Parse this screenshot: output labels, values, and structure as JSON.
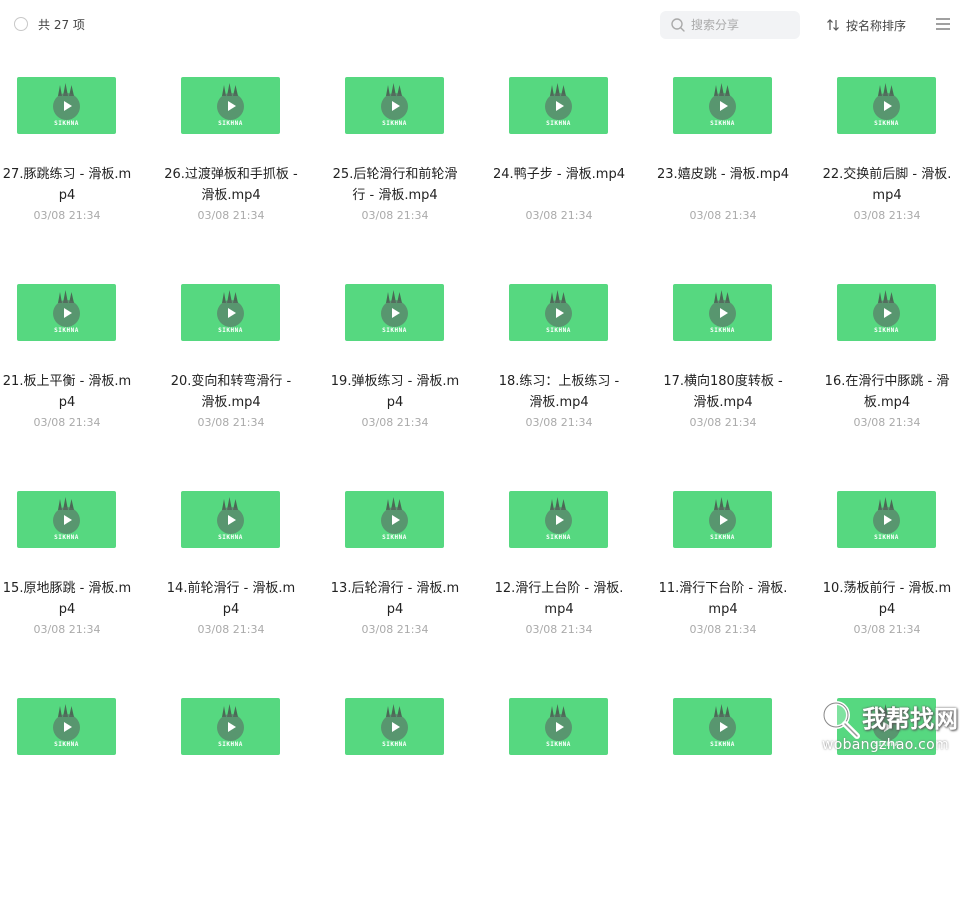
{
  "header": {
    "count_label": "共 27 项",
    "search_placeholder": "搜索分享",
    "sort_label": "按名称排序",
    "search_icon": "search-icon",
    "sort_icon": "sort-arrows-icon",
    "menu_icon": "list-menu-icon"
  },
  "thumbnail": {
    "brand": "SIKHNA",
    "color": "#56d880"
  },
  "files": [
    {
      "name": "27.豚跳练习 - 滑板.mp4",
      "time": "03/08 21:34"
    },
    {
      "name": "26.过渡弹板和手抓板 - 滑板.mp4",
      "time": "03/08 21:34"
    },
    {
      "name": "25.后轮滑行和前轮滑行 - 滑板.mp4",
      "time": "03/08 21:34"
    },
    {
      "name": "24.鸭子步 - 滑板.mp4",
      "time": "03/08 21:34"
    },
    {
      "name": "23.嬉皮跳 - 滑板.mp4",
      "time": "03/08 21:34"
    },
    {
      "name": "22.交换前后脚 - 滑板.mp4",
      "time": "03/08 21:34"
    },
    {
      "name": "21.板上平衡 - 滑板.mp4",
      "time": "03/08 21:34"
    },
    {
      "name": "20.变向和转弯滑行 - 滑板.mp4",
      "time": "03/08 21:34"
    },
    {
      "name": "19.弹板练习 - 滑板.mp4",
      "time": "03/08 21:34"
    },
    {
      "name": "18.练习：上板练习 - 滑板.mp4",
      "time": "03/08 21:34"
    },
    {
      "name": "17.横向180度转板 - 滑板.mp4",
      "time": "03/08 21:34"
    },
    {
      "name": "16.在滑行中豚跳 - 滑板.mp4",
      "time": "03/08 21:34"
    },
    {
      "name": "15.原地豚跳 - 滑板.mp4",
      "time": "03/08 21:34"
    },
    {
      "name": "14.前轮滑行 - 滑板.mp4",
      "time": "03/08 21:34"
    },
    {
      "name": "13.后轮滑行 - 滑板.mp4",
      "time": "03/08 21:34"
    },
    {
      "name": "12.滑行上台阶 - 滑板.mp4",
      "time": "03/08 21:34"
    },
    {
      "name": "11.滑行下台阶 - 滑板.mp4",
      "time": "03/08 21:34"
    },
    {
      "name": "10.荡板前行 - 滑板.mp4",
      "time": "03/08 21:34"
    },
    {
      "name": "",
      "time": ""
    },
    {
      "name": "",
      "time": ""
    },
    {
      "name": "",
      "time": ""
    },
    {
      "name": "",
      "time": ""
    },
    {
      "name": "",
      "time": ""
    },
    {
      "name": "",
      "time": ""
    }
  ],
  "watermark": {
    "title": "我帮找网",
    "url": "wobangzhao.com"
  }
}
